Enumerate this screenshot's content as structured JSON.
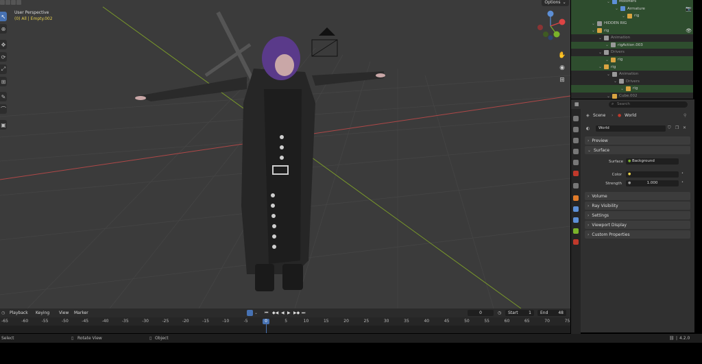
{
  "viewport": {
    "perspective_label": "User Perspective",
    "collection_label": "(0) All | Empty.002",
    "options_label": "Options",
    "gizmo_axes": [
      "X",
      "Y",
      "Z"
    ]
  },
  "outliner": {
    "rows": [
      {
        "label": "Modifiers",
        "icon_color": "#5d8fd6"
      },
      {
        "label": "Armature",
        "icon_color": "#5d8fd6"
      },
      {
        "label": "rig",
        "icon_color": "#d9a441"
      },
      {
        "label": "HIDDEN RIG",
        "icon_color": "#999999"
      },
      {
        "label": "rig",
        "icon_color": "#d9a441"
      },
      {
        "label": "Animation",
        "icon_color": "#999999"
      },
      {
        "label": "rigAction.003",
        "icon_color": "#999999"
      },
      {
        "label": "Drivers",
        "icon_color": "#999999"
      },
      {
        "label": "rig",
        "icon_color": "#d9a441"
      },
      {
        "label": "rig",
        "icon_color": "#d9a441"
      },
      {
        "label": "Animation",
        "icon_color": "#999999"
      },
      {
        "label": "Drivers",
        "icon_color": "#999999"
      },
      {
        "label": "rig",
        "icon_color": "#d9a441"
      },
      {
        "label": "Cube.002",
        "icon_color": "#d9a441"
      }
    ]
  },
  "properties": {
    "search_placeholder": "Search",
    "breadcrumb_scene": "Scene",
    "breadcrumb_world": "World",
    "world_name": "World",
    "panels": {
      "preview": "Preview",
      "surface": "Surface",
      "volume": "Volume",
      "ray_visibility": "Ray Visibility",
      "settings": "Settings",
      "viewport_display": "Viewport Display",
      "custom_properties": "Custom Properties"
    },
    "surface_label": "Surface",
    "surface_value": "Background",
    "color_label": "Color",
    "strength_label": "Strength",
    "strength_value": "1.000"
  },
  "timeline": {
    "menus": {
      "playback": "Playback",
      "keying": "Keying",
      "view": "View",
      "marker": "Marker"
    },
    "current_frame": "0",
    "start_label": "Start",
    "start_value": "1",
    "end_label": "End",
    "end_value": "48",
    "playhead_value": "0",
    "ruler": [
      "-65",
      "-60",
      "-55",
      "-50",
      "-45",
      "-40",
      "-35",
      "-30",
      "-25",
      "-20",
      "-15",
      "-10",
      "-5",
      "0",
      "5",
      "10",
      "15",
      "20",
      "25",
      "30",
      "35",
      "40",
      "45",
      "50",
      "55",
      "60",
      "65",
      "70",
      "75"
    ]
  },
  "statusbar": {
    "select": "Select",
    "rotate_view": "Rotate View",
    "object": "Object",
    "version": "4.2.0"
  },
  "colors": {
    "accent": "#4772b3",
    "outliner_selected": "#2e4d2e",
    "grid_red": "#b04848",
    "grid_green": "#7a9a2a"
  }
}
